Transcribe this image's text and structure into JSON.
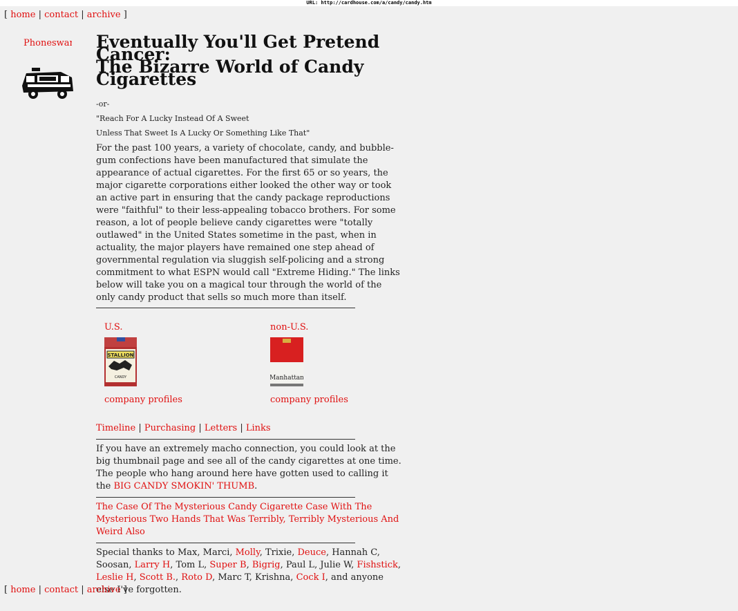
{
  "url_bar": "URL: http://cardhouse.com/a/candy/candy.htm",
  "nav": {
    "open": "[",
    "close": "]",
    "sep": "|",
    "items": [
      "home",
      "contact",
      "archive"
    ]
  },
  "sidebar": {
    "title": "Phoneswan"
  },
  "header": {
    "title_line1": "Eventually You'll Get Pretend Cancer:",
    "title_line2": "The Bizarre World of Candy Cigarettes",
    "or": "-or-",
    "alt1": "\"Reach For A Lucky Instead Of A Sweet",
    "alt2": "Unless That Sweet Is A Lucky Or Something Like That\""
  },
  "intro": "For the past 100 years, a variety of chocolate, candy, and bubble-gum confections have been manufactured that simulate the appearance of actual cigarettes. For the first 65 or so years, the major cigarette corporations either looked the other way or took an active part in ensuring that the candy package reproductions were \"faithful\" to their less-appealing tobacco brothers. For some reason, a lot of people believe candy cigarettes were \"totally outlawed\" in the United States sometime in the past, when in actuality, the major players have remained one step ahead of governmental regulation via sluggish self-policing and a strong commitment to what ESPN would call \"Extreme Hiding.\" The links below will take you on a magical tour through the world of the only candy product that sells so much more than itself.",
  "categories": {
    "us": {
      "label": "U.S.",
      "profiles": "company profiles",
      "pack_brand": "STALLION",
      "pack_text": "CANDY"
    },
    "nonus": {
      "label": "non-U.S.",
      "profiles": "company profiles",
      "pack_brand": "Manhattan"
    }
  },
  "links_row": {
    "sep": "|",
    "items": [
      "Timeline",
      "Purchasing",
      "Letters",
      "Links"
    ]
  },
  "thumb": {
    "text_before": "If you have an extremely macho connection, you could look at the big thumbnail page and see all of the candy cigarettes at one time. The people who hang around here have gotten used to calling it the ",
    "link": "BIG CANDY SMOKIN' THUMB",
    "text_after": "."
  },
  "mystery_link": "The Case Of The Mysterious Candy Cigarette Case With The Mysterious Two Hands That Was Terribly, Terribly Mysterious And Weird Also",
  "thanks": {
    "prefix": "Special thanks to ",
    "p1": "Max, Marci, ",
    "molly": "Molly",
    "p2": ", Trixie, ",
    "deuce": "Deuce",
    "p3": ", Hannah C, Soosan, ",
    "larry": "Larry H",
    "p4": ", Tom L, ",
    "superb": "Super B",
    "p5": ", ",
    "bigrig": "Bigrig",
    "p6": ", Paul L, Julie W, ",
    "fishstick": "Fishstick",
    "p7": ", ",
    "leslie": "Leslie H",
    "p8": ", ",
    "scott": "Scott B.",
    "p9": ", ",
    "roto": "Roto D",
    "p10": ", Marc T, Krishna, ",
    "cock": "Cock I",
    "p11": ", and anyone else I've forgotten."
  },
  "colors": {
    "link": "#e01010",
    "background": "#f0f0f0"
  }
}
